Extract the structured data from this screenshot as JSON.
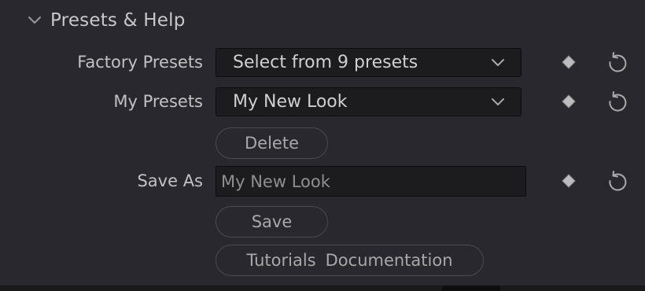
{
  "section": {
    "title": "Presets & Help",
    "expanded": true,
    "toggle_icon": "chevron-down-icon"
  },
  "factory_presets": {
    "label": "Factory Presets",
    "selected": "Select from 9 presets",
    "keyframe_icon": "diamond-keyframe-icon",
    "reset_icon": "reset-icon"
  },
  "my_presets": {
    "label": "My Presets",
    "selected": "My New Look",
    "delete_label": "Delete",
    "keyframe_icon": "diamond-keyframe-icon",
    "reset_icon": "reset-icon"
  },
  "save_as": {
    "label": "Save As",
    "placeholder": "My New Look",
    "value": "",
    "save_label": "Save",
    "keyframe_icon": "diamond-keyframe-icon",
    "reset_icon": "reset-icon"
  },
  "help": {
    "tutorials_label": "Tutorials",
    "documentation_label": "Documentation"
  },
  "colors": {
    "panel_bg": "#28282e",
    "field_bg": "#1c1c1e",
    "text": "#c8c8c8",
    "pill_border": "#4a4a50",
    "icon": "#a9a9a9"
  }
}
